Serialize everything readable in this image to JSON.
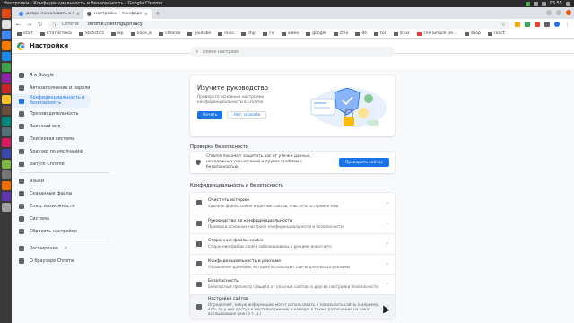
{
  "os": {
    "window_title": "Настройки - Конфиденциальность и безопасность - Google Chrome",
    "clock": "03:55"
  },
  "tabs": [
    {
      "label": "Добро пожаловать в Chro",
      "favicon_color": "#4285f4"
    },
    {
      "label": "Настройки – Конфиденц",
      "favicon_color": "#5f6368"
    }
  ],
  "new_tab_label": "+",
  "omnibox": {
    "host": "Chrome",
    "sep": "|",
    "url": "chrome://settings/privacy"
  },
  "bookmarks": [
    {
      "label": "start"
    },
    {
      "label": "Статистика"
    },
    {
      "label": "Statistics"
    },
    {
      "label": "wp"
    },
    {
      "label": "node.js"
    },
    {
      "label": "chrome"
    },
    {
      "label": "youtube"
    },
    {
      "label": "links"
    },
    {
      "label": "php"
    },
    {
      "label": "TV"
    },
    {
      "label": "video"
    },
    {
      "label": "google"
    },
    {
      "label": "chin"
    },
    {
      "label": "de"
    },
    {
      "label": "tor"
    },
    {
      "label": "linux"
    },
    {
      "label": "The Simple De…"
    },
    {
      "label": "shop"
    },
    {
      "label": "react"
    }
  ],
  "header": {
    "title": "Настройки",
    "search_placeholder": "Поиск настроек"
  },
  "sidebar": {
    "items": [
      {
        "label": "Я и Google",
        "icon": "person-icon"
      },
      {
        "label": "Автозаполнение и пароли",
        "icon": "autofill-icon"
      },
      {
        "label": "Конфиденциальность и безопасность",
        "icon": "shield-icon",
        "active": true
      },
      {
        "label": "Производительность",
        "icon": "speed-icon"
      },
      {
        "label": "Внешний вид",
        "icon": "palette-icon"
      },
      {
        "label": "Поисковая система",
        "icon": "search-icon"
      },
      {
        "label": "Браузер по умолчанию",
        "icon": "browser-icon"
      },
      {
        "label": "Запуск Chrome",
        "icon": "power-icon"
      },
      {
        "label": "Языки",
        "icon": "language-icon"
      },
      {
        "label": "Скачанные файлы",
        "icon": "download-icon"
      },
      {
        "label": "Спец. возможности",
        "icon": "accessibility-icon"
      },
      {
        "label": "Система",
        "icon": "wrench-icon"
      },
      {
        "label": "Сбросить настройки",
        "icon": "reset-icon"
      },
      {
        "label": "Расширения",
        "icon": "puzzle-icon"
      },
      {
        "label": "О браузере Chrome",
        "icon": "chrome-icon"
      }
    ]
  },
  "guide_card": {
    "title": "Изучите руководство",
    "text": "Проверьте основные настройки конфиденциальности в Chrome",
    "start_label": "Начать",
    "decline_label": "Нет, спасибо"
  },
  "safety_check": {
    "section_title": "Проверка безопасности",
    "text": "Chrome поможет защитить вас от утечки данных, ненадежных расширений и других проблем с безопасностью.",
    "button_label": "Проверить сейчас"
  },
  "privacy": {
    "section_title": "Конфиденциальность и безопасность",
    "rows": [
      {
        "title": "Очистить историю",
        "subtitle": "Удалить файлы cookie и данные сайтов, очистить историю и кеш",
        "icon": "trash-icon"
      },
      {
        "title": "Руководство по конфиденциальности",
        "subtitle": "Проверка основных настроек конфиденциальности и безопасности",
        "icon": "guide-icon"
      },
      {
        "title": "Сторонние файлы cookie",
        "subtitle": "Сторонние файлы cookie заблокированы в режиме инкогнито",
        "icon": "cookie-icon"
      },
      {
        "title": "Конфиденциальность в рекламе",
        "subtitle": "Управление данными, которые используют сайты для показа рекламы",
        "icon": "ads-icon"
      },
      {
        "title": "Безопасность",
        "subtitle": "Безопасный просмотр (защита от опасных сайтов) и другие настройки безопасности",
        "icon": "security-icon"
      },
      {
        "title": "Настройки сайтов",
        "subtitle": "Определяет, какую информацию могут использовать и показывать сайты (например, есть ли у них доступ к местоположению и камере, а также разрешение на показ всплывающих окон и т. д.)",
        "icon": "site-settings-icon"
      }
    ]
  },
  "colors": {
    "accent": "#1a73e8",
    "active_bg": "#e8f0fe",
    "background": "#f8f9fa"
  }
}
